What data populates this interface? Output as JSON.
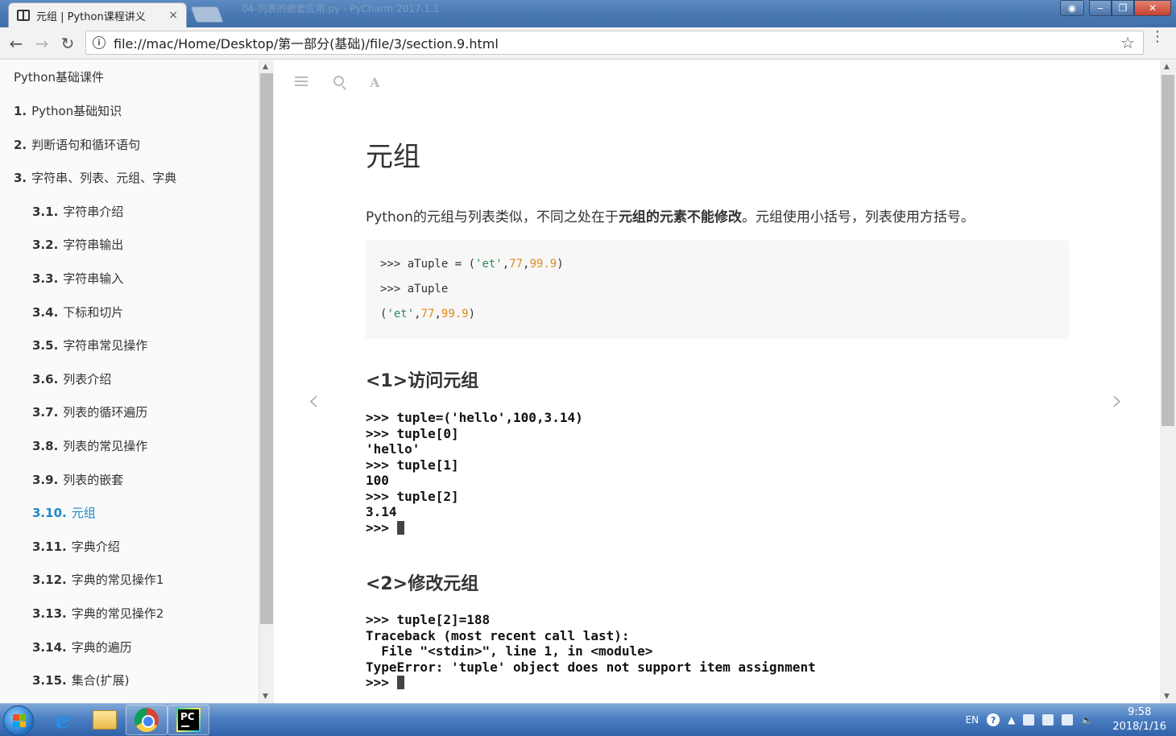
{
  "browser": {
    "tab_title": "元组 | Python课程讲义",
    "tab_close": "×",
    "background_window_title": "04-列表的嵌套应用.py - PyCharm 2017.1.1",
    "url": "file://mac/Home/Desktop/第一部分(基础)/file/3/section.9.html",
    "back_glyph": "←",
    "forward_glyph": "→",
    "reload_glyph": "↻",
    "star_glyph": "☆",
    "menu_glyph": "⋮",
    "min_glyph": "‒",
    "max_glyph": "❐",
    "close_glyph": "✕"
  },
  "sidebar": {
    "title": "Python基础课件",
    "items": [
      {
        "num": "1.",
        "label": "Python基础知识"
      },
      {
        "num": "2.",
        "label": "判断语句和循环语句"
      },
      {
        "num": "3.",
        "label": "字符串、列表、元组、字典"
      },
      {
        "num": "3.1.",
        "label": "字符串介绍"
      },
      {
        "num": "3.2.",
        "label": "字符串输出"
      },
      {
        "num": "3.3.",
        "label": "字符串输入"
      },
      {
        "num": "3.4.",
        "label": "下标和切片"
      },
      {
        "num": "3.5.",
        "label": "字符串常见操作"
      },
      {
        "num": "3.6.",
        "label": "列表介绍"
      },
      {
        "num": "3.7.",
        "label": "列表的循环遍历"
      },
      {
        "num": "3.8.",
        "label": "列表的常见操作"
      },
      {
        "num": "3.9.",
        "label": "列表的嵌套"
      },
      {
        "num": "3.10.",
        "label": "元组"
      },
      {
        "num": "3.11.",
        "label": "字典介绍"
      },
      {
        "num": "3.12.",
        "label": "字典的常见操作1"
      },
      {
        "num": "3.13.",
        "label": "字典的常见操作2"
      },
      {
        "num": "3.14.",
        "label": "字典的遍历"
      },
      {
        "num": "3.15.",
        "label": "集合(扩展)"
      }
    ],
    "active_index": 12
  },
  "content": {
    "title": "元组",
    "intro_prefix": "Python的元组与列表类似，不同之处在于",
    "intro_strong": "元组的元素不能修改",
    "intro_suffix": "。元组使用小括号，列表使用方括号。",
    "code": {
      "line1_prompt": ">>> aTuple = (",
      "line1_str": "'et'",
      "line1_sep1": ",",
      "line1_num1": "77",
      "line1_sep2": ",",
      "line1_num2": "99.9",
      "line1_end": ")",
      "line2": ">>> aTuple",
      "line3_start": "(",
      "line3_str": "'et'",
      "line3_sep1": ",",
      "line3_num1": "77",
      "line3_sep2": ",",
      "line3_num2": "99.9",
      "line3_end": ")"
    },
    "section1": {
      "bracket": "<1>",
      "title": "访问元组",
      "lines": [
        ">>> tuple=('hello',100,3.14)",
        ">>> tuple[0]",
        "'hello'",
        ">>> tuple[1]",
        "100",
        ">>> tuple[2]",
        "3.14",
        ">>> "
      ]
    },
    "section2": {
      "bracket": "<2>",
      "title": "修改元组",
      "lines": [
        ">>> tuple[2]=188",
        "Traceback (most recent call last):",
        "  File \"<stdin>\", line 1, in <module>",
        "TypeError: 'tuple' object does not support item assignment",
        ">>> "
      ]
    },
    "prev_glyph": "‹",
    "next_glyph": "›",
    "font_icon_letter": "A"
  },
  "taskbar": {
    "lang": "EN",
    "help": "?",
    "time": "9:58",
    "date": "2018/1/16",
    "pycharm_label": "PC"
  }
}
